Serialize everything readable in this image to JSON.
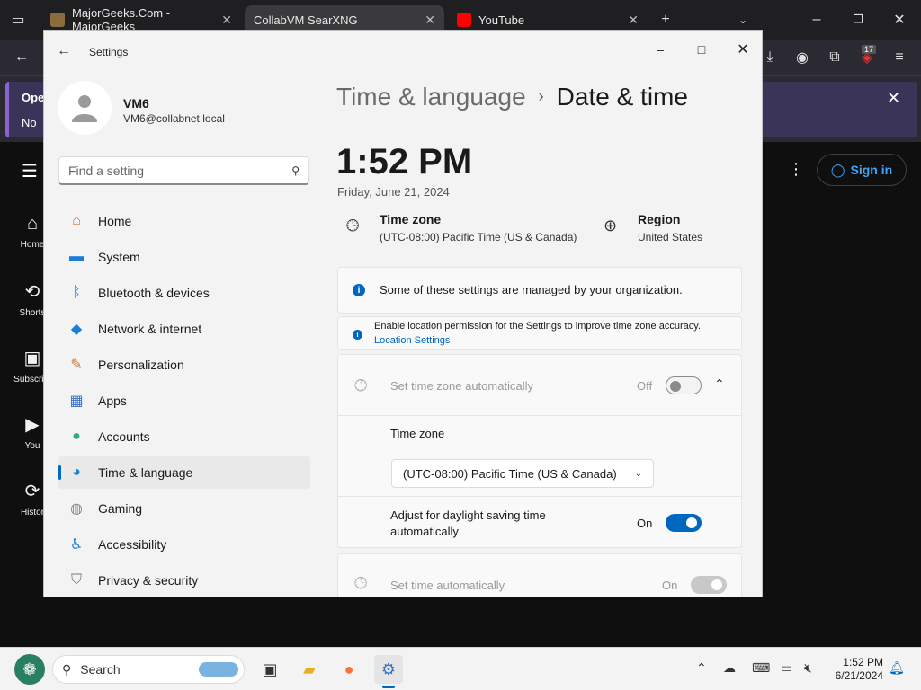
{
  "browser": {
    "tabs": [
      {
        "title": "MajorGeeks.Com - MajorGeeks",
        "favicon_color": "#8b6b3d"
      },
      {
        "title": "CollabVM SearXNG",
        "favicon_color": "#2b2a33"
      },
      {
        "title": "YouTube",
        "favicon_color": "#ff0000"
      }
    ],
    "extension_badge": "17"
  },
  "youtube": {
    "sidebar": [
      {
        "label": "Home",
        "icon": "home-icon"
      },
      {
        "label": "Shorts",
        "icon": "shorts-icon"
      },
      {
        "label": "Subscript",
        "icon": "subscriptions-icon"
      },
      {
        "label": "You",
        "icon": "you-icon"
      },
      {
        "label": "Histor",
        "icon": "history-icon"
      }
    ],
    "sign_in": "Sign in",
    "notice_button": "No",
    "notice_text": "Oper"
  },
  "settings": {
    "app_title": "Settings",
    "user": {
      "name": "VM6",
      "email": "VM6@collabnet.local"
    },
    "search_placeholder": "Find a setting",
    "nav": [
      {
        "label": "Home",
        "icon": "home-icon",
        "color": "#d4703a"
      },
      {
        "label": "System",
        "icon": "monitor-icon",
        "color": "#1a7fd4"
      },
      {
        "label": "Bluetooth & devices",
        "icon": "bluetooth-icon",
        "color": "#1a7fd4"
      },
      {
        "label": "Network & internet",
        "icon": "wifi-icon",
        "color": "#1a7fd4"
      },
      {
        "label": "Personalization",
        "icon": "brush-icon",
        "color": "#c87533"
      },
      {
        "label": "Apps",
        "icon": "apps-icon",
        "color": "#3a6fc4"
      },
      {
        "label": "Accounts",
        "icon": "person-icon",
        "color": "#2eaa8a"
      },
      {
        "label": "Time & language",
        "icon": "globe-clock-icon",
        "color": "#1a7fd4"
      },
      {
        "label": "Gaming",
        "icon": "gamepad-icon",
        "color": "#888888"
      },
      {
        "label": "Accessibility",
        "icon": "accessibility-icon",
        "color": "#1a7fd4"
      },
      {
        "label": "Privacy & security",
        "icon": "shield-icon",
        "color": "#777777"
      }
    ],
    "selected_nav": "Time & language",
    "breadcrumb": {
      "parent": "Time & language",
      "current": "Date & time"
    },
    "clock": "1:52 PM",
    "date": "Friday, June 21, 2024",
    "time_zone": {
      "label": "Time zone",
      "value": "(UTC-08:00) Pacific Time (US & Canada)"
    },
    "region": {
      "label": "Region",
      "value": "United States"
    },
    "managed_notice": "Some of these settings are managed by your organization.",
    "location_notice": "Enable location permission for the Settings to improve time zone accuracy.",
    "location_link": "Location Settings",
    "auto_timezone": {
      "label": "Set time zone automatically",
      "state": "Off"
    },
    "tz_dropdown": {
      "label": "Time zone",
      "value": "(UTC-08:00) Pacific Time (US & Canada)"
    },
    "dst": {
      "label_line1": "Adjust for daylight saving time",
      "label_line2": "automatically",
      "state": "On"
    },
    "auto_time": {
      "label": "Set time automatically",
      "state": "On"
    }
  },
  "taskbar": {
    "search": "Search",
    "time": "1:52 PM",
    "date": "6/21/2024"
  }
}
